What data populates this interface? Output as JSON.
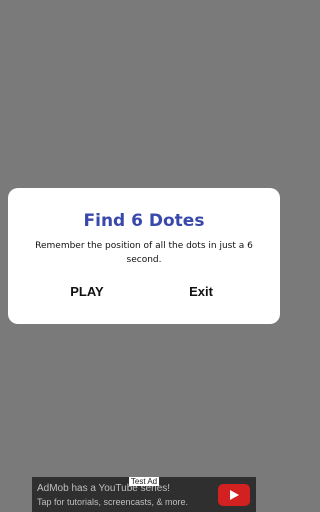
{
  "dialog": {
    "title": "Find 6 Dotes",
    "message": "Remember the position of all the dots in just a 6 second.",
    "play_label": "PLAY",
    "exit_label": "Exit"
  },
  "ad": {
    "tag": "Test Ad",
    "line1": "AdMob has a YouTube series!",
    "line2": "Tap for tutorials, screencasts, & more.",
    "icon": "youtube-play-icon"
  },
  "colors": {
    "overlay": "#7a7a7a",
    "title": "#3949ab",
    "dialog_bg": "#ffffff"
  }
}
